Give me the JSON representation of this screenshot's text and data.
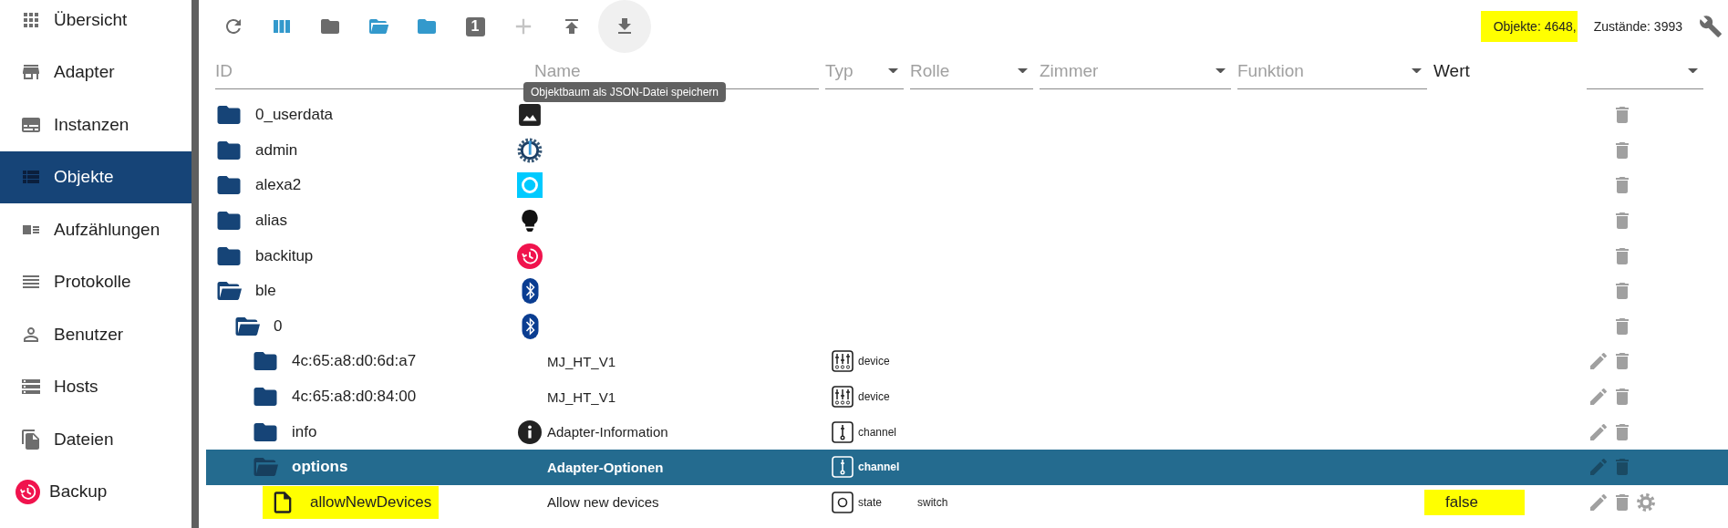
{
  "sidebar": {
    "items": [
      {
        "label": "Übersicht",
        "selected": false
      },
      {
        "label": "Adapter",
        "selected": false
      },
      {
        "label": "Instanzen",
        "selected": false
      },
      {
        "label": "Objekte",
        "selected": true
      },
      {
        "label": "Aufzählungen",
        "selected": false
      },
      {
        "label": "Protokolle",
        "selected": false
      },
      {
        "label": "Benutzer",
        "selected": false
      },
      {
        "label": "Hosts",
        "selected": false
      },
      {
        "label": "Dateien",
        "selected": false
      },
      {
        "label": "Backup",
        "selected": false
      }
    ]
  },
  "toolbar": {
    "buttons": [
      {
        "active": false,
        "disabled": false,
        "hovered": false
      },
      {
        "active": true,
        "disabled": false,
        "hovered": false
      },
      {
        "active": false,
        "disabled": false,
        "hovered": false
      },
      {
        "active": true,
        "disabled": false,
        "hovered": false
      },
      {
        "active": true,
        "disabled": false,
        "hovered": false
      },
      {
        "label": "1",
        "active": false,
        "disabled": false,
        "hovered": false
      },
      {
        "active": false,
        "disabled": true,
        "hovered": false
      },
      {
        "active": false,
        "disabled": false,
        "hovered": false
      },
      {
        "active": false,
        "disabled": false,
        "hovered": true,
        "tooltip": "Objektbaum als JSON-Datei speichern"
      }
    ],
    "stats": [
      {
        "text": "Objekte: 4648,",
        "highlighted": true
      },
      {
        "text": "Zustände: 3993",
        "highlighted": false
      }
    ]
  },
  "filters": [
    {
      "label": "ID",
      "kind": "text"
    },
    {
      "label": "Name",
      "kind": "text"
    },
    {
      "label": "Typ",
      "kind": "select"
    },
    {
      "label": "Rolle",
      "kind": "select"
    },
    {
      "label": "Zimmer",
      "kind": "select"
    },
    {
      "label": "Funktion",
      "kind": "select"
    },
    {
      "label": "Wert",
      "kind": "label"
    },
    {
      "kind": "select"
    }
  ],
  "tree": [
    {
      "id": "0_userdata",
      "kind": "folder",
      "expanded": false,
      "selected": false,
      "highlighted": false,
      "editable": false
    },
    {
      "id": "admin",
      "kind": "folder",
      "expanded": false,
      "selected": false,
      "highlighted": false,
      "editable": false
    },
    {
      "id": "alexa2",
      "kind": "folder",
      "expanded": false,
      "selected": false,
      "highlighted": false,
      "editable": false
    },
    {
      "id": "alias",
      "kind": "folder",
      "expanded": false,
      "selected": false,
      "highlighted": false,
      "editable": false
    },
    {
      "id": "backitup",
      "kind": "folder",
      "expanded": false,
      "selected": false,
      "highlighted": false,
      "editable": false
    },
    {
      "id": "ble",
      "kind": "folder",
      "expanded": true,
      "selected": false,
      "highlighted": false,
      "editable": false,
      "children": [
        {
          "id": "0",
          "kind": "folder",
          "expanded": true,
          "selected": false,
          "highlighted": false,
          "editable": false,
          "children": [
            {
              "id": "4c:65:a8:d0:6d:a7",
              "kind": "folder",
              "expanded": false,
              "selected": false,
              "highlighted": false,
              "name": "MJ_HT_V1",
              "type": "device",
              "editable": true
            },
            {
              "id": "4c:65:a8:d0:84:00",
              "kind": "folder",
              "expanded": false,
              "selected": false,
              "highlighted": false,
              "name": "MJ_HT_V1",
              "type": "device",
              "editable": true
            },
            {
              "id": "info",
              "kind": "folder",
              "expanded": false,
              "selected": false,
              "highlighted": false,
              "name": "Adapter-Information",
              "type": "channel",
              "editable": true
            },
            {
              "id": "options",
              "kind": "folder",
              "expanded": true,
              "selected": true,
              "highlighted": false,
              "name": "Adapter-Optionen",
              "type": "channel",
              "editable": true,
              "children": [
                {
                  "id": "allowNewDevices",
                  "kind": "file",
                  "selected": false,
                  "highlighted": true,
                  "name": "Allow new devices",
                  "type": "state",
                  "role": "switch",
                  "value": "false",
                  "value_highlighted": true,
                  "editable": true,
                  "configurable": true
                }
              ]
            }
          ]
        }
      ]
    }
  ]
}
